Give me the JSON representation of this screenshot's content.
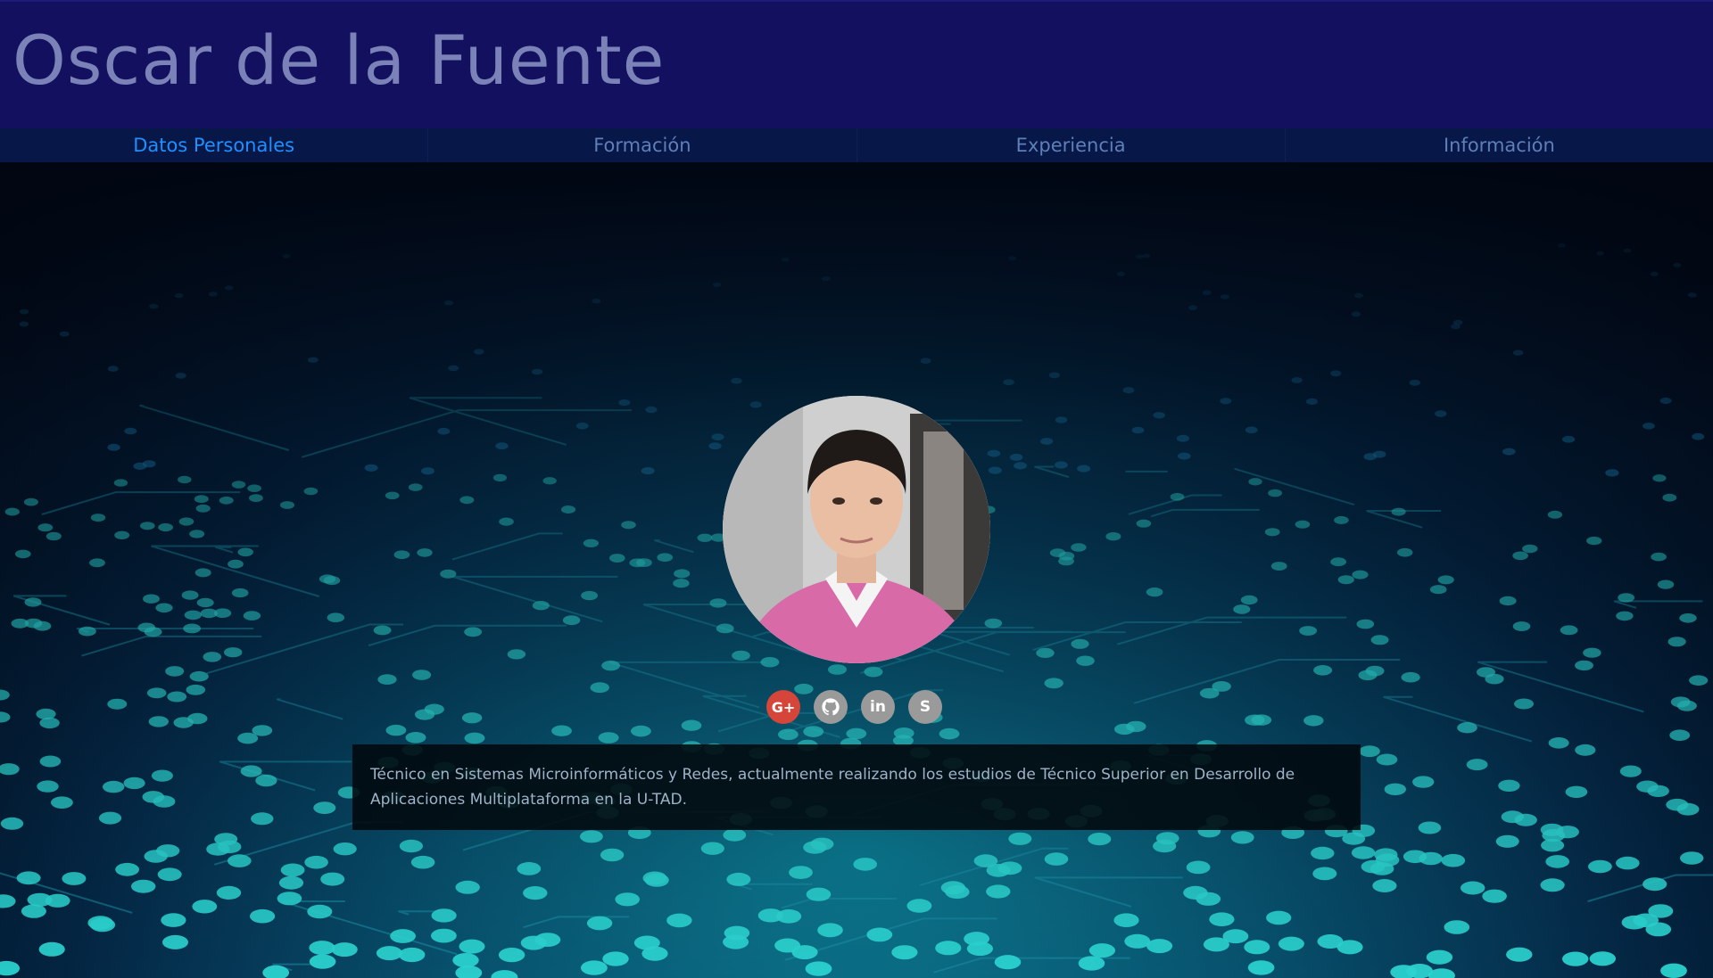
{
  "header": {
    "title": "Oscar de la Fuente"
  },
  "nav": {
    "items": [
      {
        "label": "Datos Personales",
        "active": true
      },
      {
        "label": "Formación",
        "active": false
      },
      {
        "label": "Experiencia",
        "active": false
      },
      {
        "label": "Información",
        "active": false
      }
    ]
  },
  "profile": {
    "photo_alt": "profile-photo",
    "social": [
      {
        "icon": "google-plus-icon",
        "glyph": "G+",
        "color": "#d6453a"
      },
      {
        "icon": "github-icon",
        "glyph": "",
        "color": "#9a9a9a"
      },
      {
        "icon": "linkedin-icon",
        "glyph": "in",
        "color": "#9a9a9a"
      },
      {
        "icon": "skype-icon",
        "glyph": "S",
        "color": "#9a9a9a"
      }
    ],
    "bio": "Técnico en Sistemas Microinformáticos y Redes, actualmente realizando los estudios de Técnico Superior en Desarrollo de Aplicaciones Multiplataforma en la U-TAD."
  },
  "colors": {
    "header_bg": "#12105f",
    "nav_bg": "#061748",
    "nav_active": "#1e90ff",
    "nav_inactive": "#5e7fb8",
    "title": "#7b82b8"
  }
}
